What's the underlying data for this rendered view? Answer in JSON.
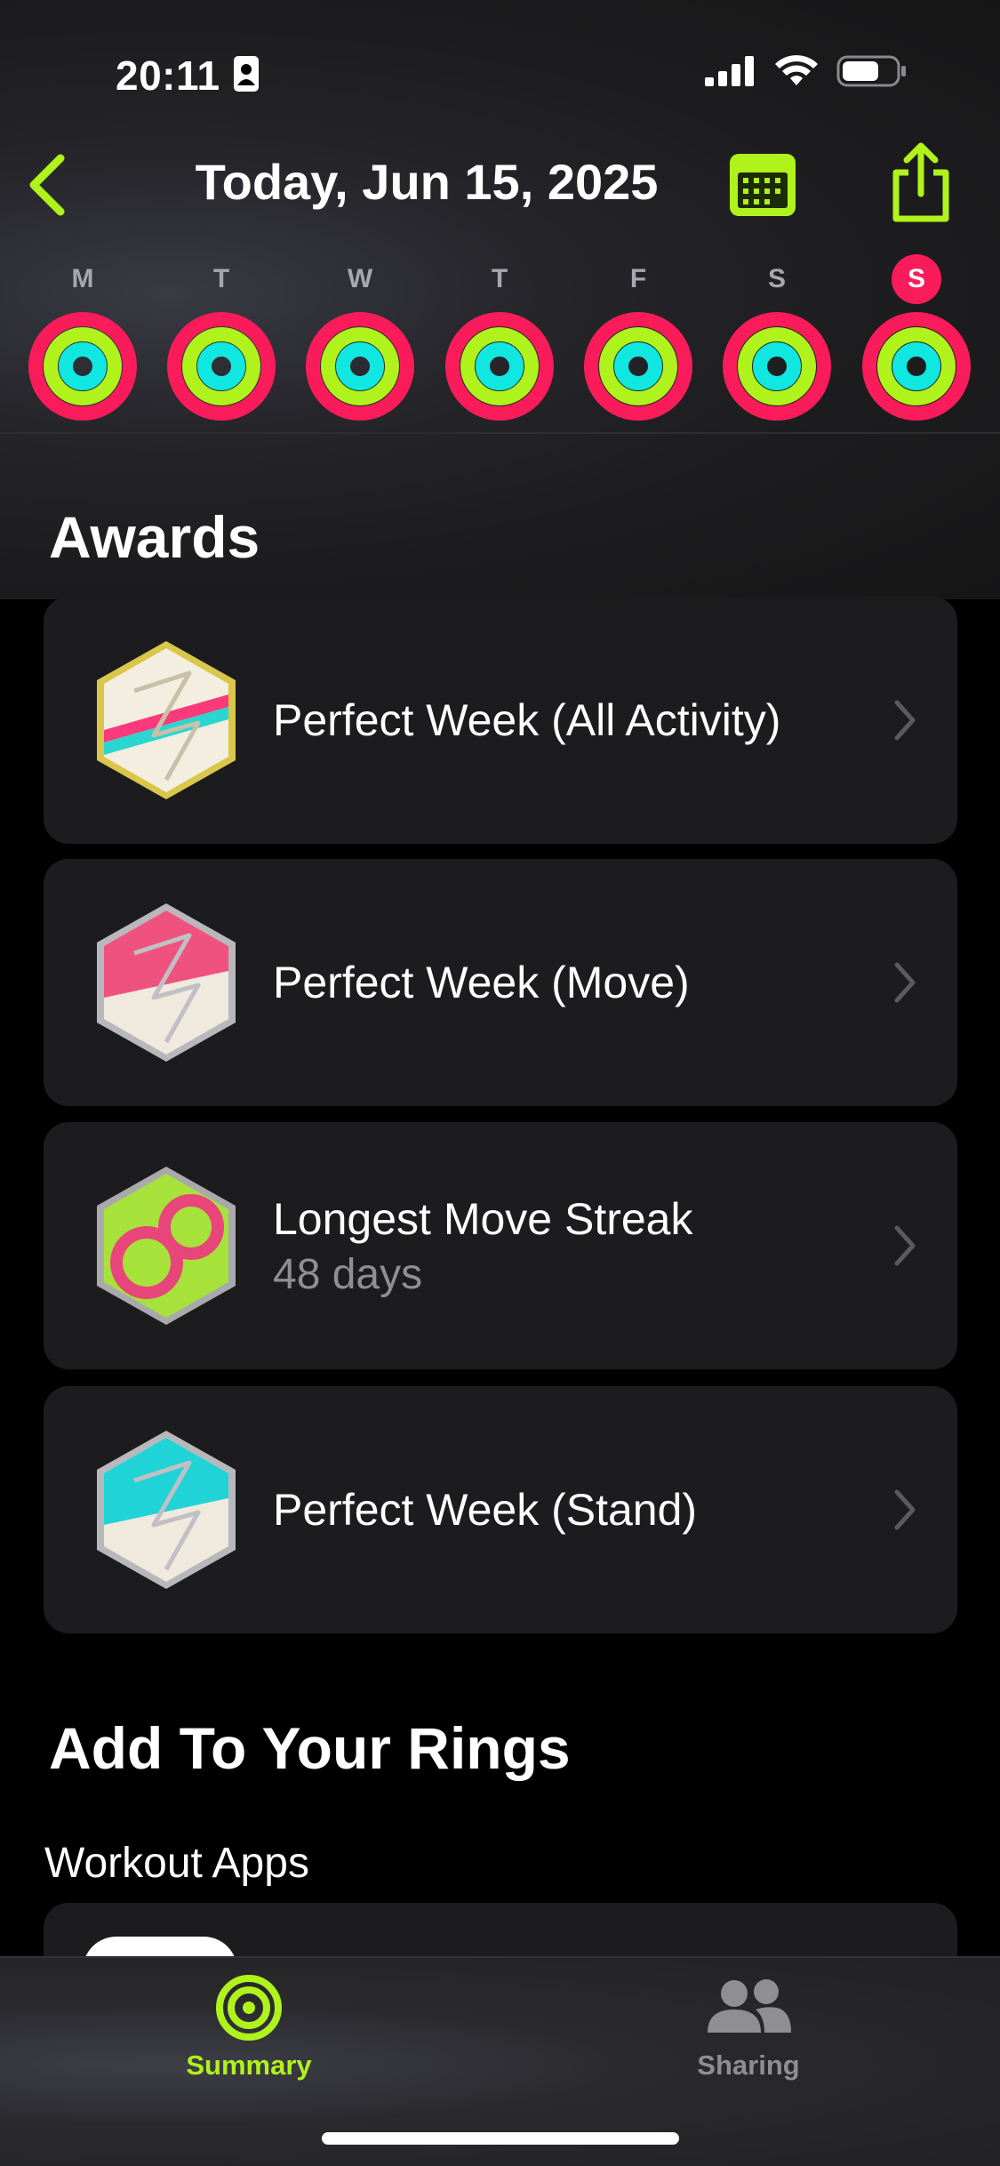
{
  "status_bar": {
    "time": "20:11",
    "icons": [
      "contact-card-icon",
      "signal-icon",
      "wifi-icon",
      "battery-icon"
    ]
  },
  "nav": {
    "title": "Today, Jun 15, 2025",
    "icons": [
      "chevron-left-icon",
      "calendar-icon",
      "share-icon"
    ]
  },
  "week": {
    "days": [
      "M",
      "T",
      "W",
      "T",
      "F",
      "S",
      "S"
    ],
    "selected_index": 6
  },
  "awards": {
    "heading": "Awards",
    "items": [
      {
        "title": "Perfect Week (All Activity)",
        "subtitle": "",
        "badge": "perfect-week-all-activity-badge"
      },
      {
        "title": "Perfect Week (Move)",
        "subtitle": "",
        "badge": "perfect-week-move-badge"
      },
      {
        "title": "Longest Move Streak",
        "subtitle": "48 days",
        "badge": "longest-move-streak-badge"
      },
      {
        "title": "Perfect Week (Stand)",
        "subtitle": "",
        "badge": "perfect-week-stand-badge"
      }
    ]
  },
  "add_rings": {
    "heading": "Add To Your Rings",
    "subheading": "Workout Apps"
  },
  "tabbar": {
    "tabs": [
      {
        "label": "Summary",
        "icon": "summary-rings-icon",
        "active": true
      },
      {
        "label": "Sharing",
        "icon": "sharing-people-icon",
        "active": false
      }
    ]
  },
  "colors": {
    "accent": "#b0f21b",
    "move": "#fa1c5a",
    "exercise": "#b0f21b",
    "stand": "#10e7e0",
    "card": "#1c1c1e",
    "secondary_text": "#8e8e93"
  }
}
